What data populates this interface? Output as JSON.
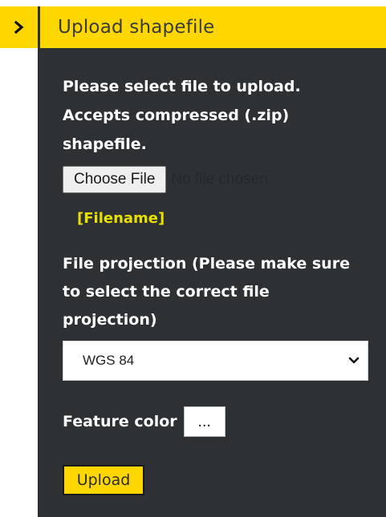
{
  "colors": {
    "accent": "#FFD700",
    "panel_background": "#2d3134",
    "filename_text": "#E8E000"
  },
  "toggle": {
    "icon": "chevron-right-icon"
  },
  "header": {
    "title": "Upload shapefile"
  },
  "upload_section": {
    "instructions": "Please select file to upload. Accepts compressed (.zip) shapefile.",
    "choose_file_label": "Choose File",
    "no_file_text": "No file chosen",
    "filename_placeholder": "[Filename]"
  },
  "projection": {
    "label": "File projection (Please make sure to select the correct file projection)",
    "selected": "WGS 84",
    "icon": "chevron-down-icon"
  },
  "feature_color": {
    "label": "Feature color",
    "button_label": "..."
  },
  "actions": {
    "upload_label": "Upload"
  }
}
